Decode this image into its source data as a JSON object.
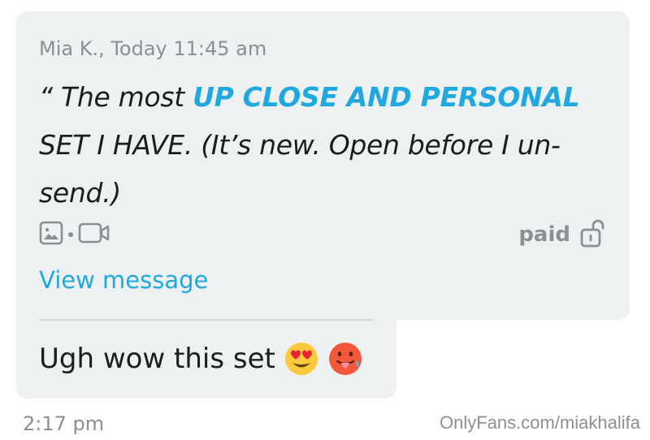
{
  "message": {
    "meta": "Mia K., Today 11:45 am",
    "quote_open": "“ The most ",
    "quote_highlight": "UP CLOSE AND PERSONAL",
    "quote_rest": " SET I HAVE. (It’s new. Open before I un-send.)",
    "media_icons": [
      "image-icon",
      "video-icon"
    ],
    "paid_label": "paid",
    "paid_icon": "unlock-icon",
    "view_message": "View message"
  },
  "reply": {
    "text": "Ugh wow this set",
    "emojis": [
      "heart-eyes-emoji",
      "hot-face-emoji"
    ]
  },
  "footer": {
    "time": "2:17 pm",
    "watermark": "OnlyFans.com/miakhalifa"
  },
  "colors": {
    "accent": "#20a9e0",
    "bubble": "#eef1f2",
    "muted": "#8a9095",
    "text": "#1b1d1f"
  }
}
